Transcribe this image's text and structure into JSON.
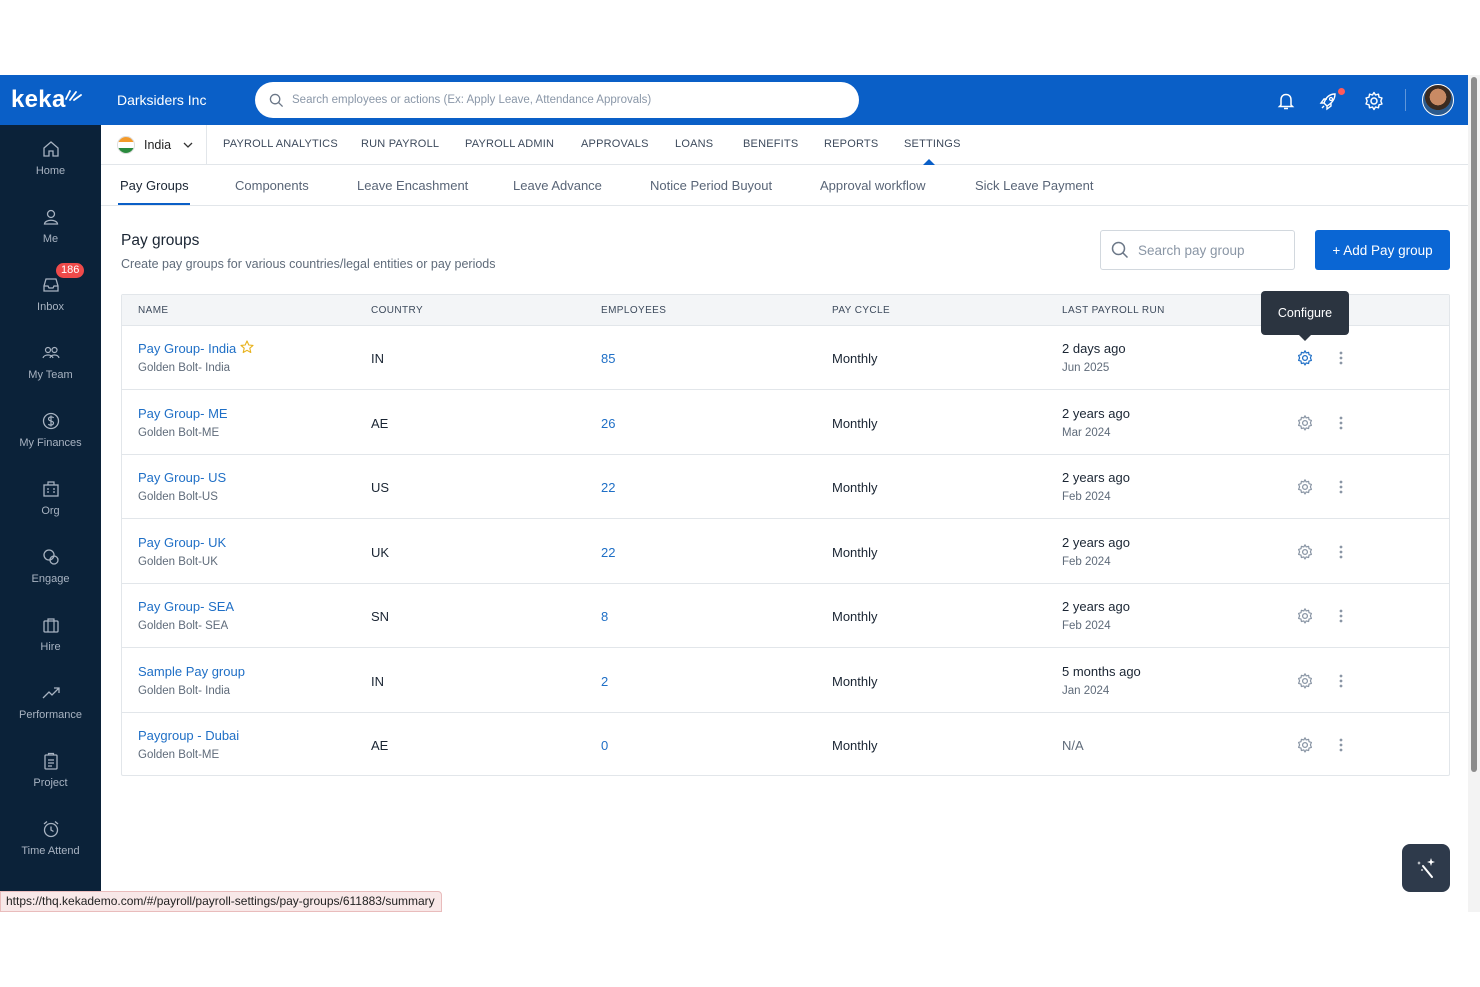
{
  "sidebar": {
    "logo": "keka",
    "items": [
      {
        "label": "Home",
        "icon": "home-icon"
      },
      {
        "label": "Me",
        "icon": "user-icon"
      },
      {
        "label": "Inbox",
        "icon": "inbox-icon",
        "badge": "186"
      },
      {
        "label": "My Team",
        "icon": "team-icon"
      },
      {
        "label": "My Finances",
        "icon": "dollar-icon"
      },
      {
        "label": "Org",
        "icon": "org-icon"
      },
      {
        "label": "Engage",
        "icon": "engage-icon"
      },
      {
        "label": "Hire",
        "icon": "briefcase-icon"
      },
      {
        "label": "Performance",
        "icon": "trend-icon"
      },
      {
        "label": "Project",
        "icon": "clipboard-icon"
      },
      {
        "label": "Time Attend",
        "icon": "alarm-icon"
      }
    ]
  },
  "header": {
    "company": "Darksiders Inc",
    "search_placeholder": "Search employees or actions (Ex: Apply Leave, Attendance Approvals)"
  },
  "subnav": {
    "country": "India",
    "items": [
      "PAYROLL ANALYTICS",
      "RUN PAYROLL",
      "PAYROLL ADMIN",
      "APPROVALS",
      "LOANS",
      "BENEFITS",
      "REPORTS",
      "SETTINGS"
    ],
    "active": "SETTINGS"
  },
  "tabs": {
    "items": [
      "Pay Groups",
      "Components",
      "Leave Encashment",
      "Leave Advance",
      "Notice Period Buyout",
      "Approval workflow",
      "Sick Leave Payment"
    ],
    "active": "Pay Groups"
  },
  "main": {
    "title": "Pay groups",
    "subtitle": "Create pay groups for various countries/legal entities or pay periods",
    "search_placeholder": "Search pay group",
    "add_button": "+ Add Pay group"
  },
  "table": {
    "columns": [
      "NAME",
      "COUNTRY",
      "EMPLOYEES",
      "PAY CYCLE",
      "LAST PAYROLL RUN"
    ],
    "rows": [
      {
        "name": "Pay Group- India",
        "entity": "Golden Bolt- India",
        "country": "IN",
        "employees": "85",
        "cycle": "Monthly",
        "last_run": "2 days ago",
        "last_date": "Jun 2025",
        "starred": true
      },
      {
        "name": "Pay Group- ME",
        "entity": "Golden Bolt-ME",
        "country": "AE",
        "employees": "26",
        "cycle": "Monthly",
        "last_run": "2 years ago",
        "last_date": "Mar 2024"
      },
      {
        "name": "Pay Group- US",
        "entity": "Golden Bolt-US",
        "country": "US",
        "employees": "22",
        "cycle": "Monthly",
        "last_run": "2 years ago",
        "last_date": "Feb 2024"
      },
      {
        "name": "Pay Group- UK",
        "entity": "Golden Bolt-UK",
        "country": "UK",
        "employees": "22",
        "cycle": "Monthly",
        "last_run": "2 years ago",
        "last_date": "Feb 2024"
      },
      {
        "name": "Pay Group- SEA",
        "entity": "Golden Bolt- SEA",
        "country": "SN",
        "employees": "8",
        "cycle": "Monthly",
        "last_run": "2 years ago",
        "last_date": "Feb 2024"
      },
      {
        "name": "Sample Pay group",
        "entity": "Golden Bolt- India",
        "country": "IN",
        "employees": "2",
        "cycle": "Monthly",
        "last_run": "5 months ago",
        "last_date": "Jan 2024"
      },
      {
        "name": "Paygroup - Dubai",
        "entity": "Golden Bolt-ME",
        "country": "AE",
        "employees": "0",
        "cycle": "Monthly",
        "last_run": "N/A",
        "last_date": ""
      }
    ]
  },
  "tooltip": "Configure",
  "status_url": "https://thq.kekademo.com/#/payroll/payroll-settings/pay-groups/611883/summary",
  "colors": {
    "brand_blue": "#0a5fc7",
    "sidebar_bg": "#0b2239",
    "link_blue": "#1f6fc6",
    "badge_red": "#ef4a4a"
  }
}
